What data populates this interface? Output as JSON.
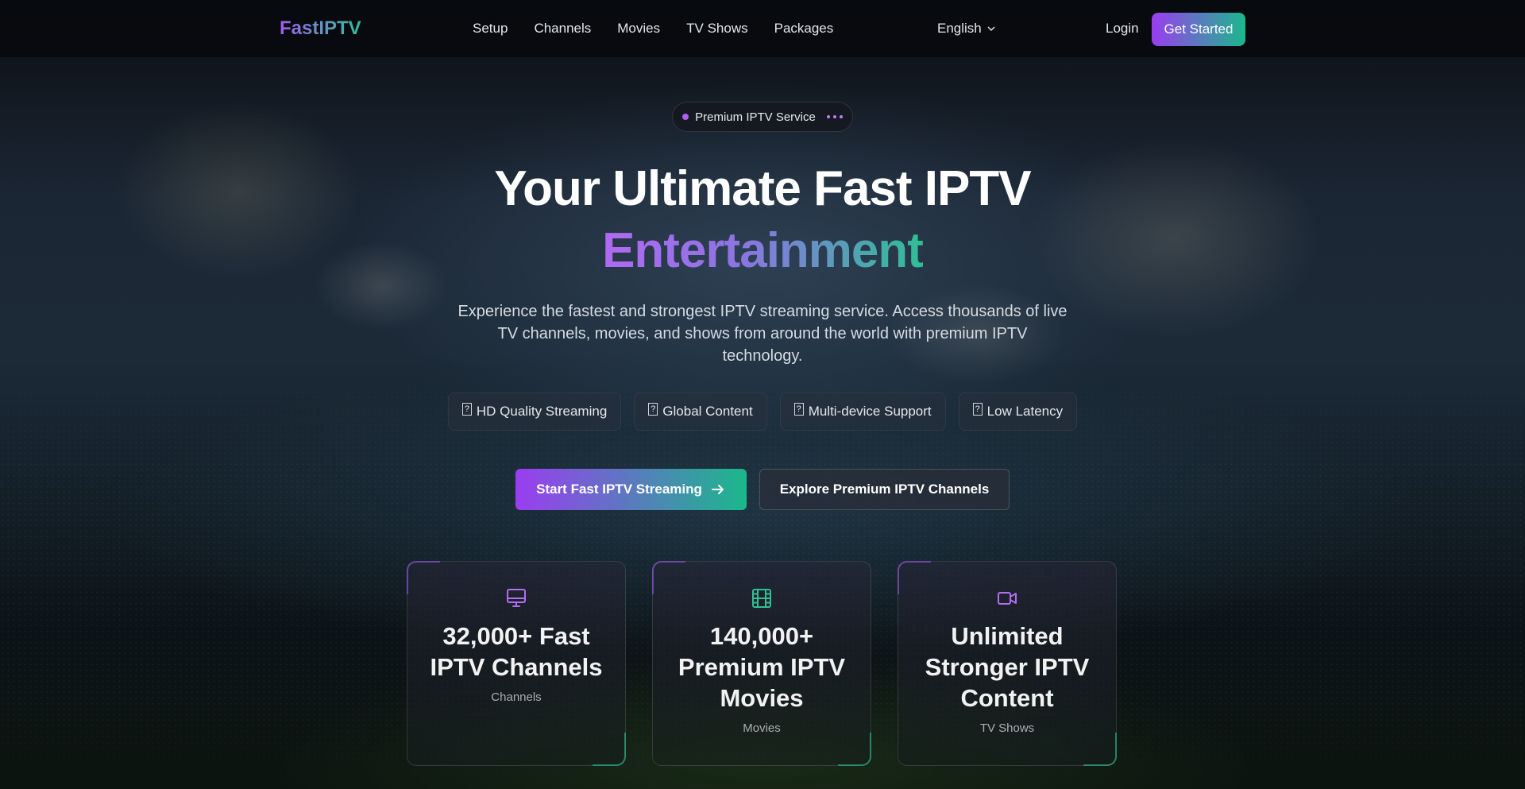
{
  "brand": {
    "logo": "FastIPTV",
    "accent_purple": "#9a3df0",
    "accent_green": "#1bb88c"
  },
  "nav": {
    "links": [
      "Setup",
      "Channels",
      "Movies",
      "TV Shows",
      "Packages"
    ],
    "language": "English",
    "login": "Login",
    "get_started": "Get Started"
  },
  "hero": {
    "badge": "Premium IPTV Service",
    "title_line1": "Your Ultimate Fast IPTV",
    "title_line2": "Entertainment",
    "subtitle": "Experience the fastest and strongest IPTV streaming service. Access thousands of live TV channels, movies, and shows from around the world with premium IPTV technology.",
    "features": [
      {
        "icon": "unknown-glyph-icon",
        "label": "HD Quality Streaming"
      },
      {
        "icon": "unknown-glyph-icon",
        "label": "Global Content"
      },
      {
        "icon": "unknown-glyph-icon",
        "label": "Multi-device Support"
      },
      {
        "icon": "unknown-glyph-icon",
        "label": "Low Latency"
      }
    ],
    "primary_cta": "Start Fast IPTV Streaming",
    "secondary_cta": "Explore Premium IPTV Channels"
  },
  "stats": [
    {
      "icon": "monitor-icon",
      "title": "32,000+ Fast IPTV Channels",
      "label": "Channels"
    },
    {
      "icon": "film-icon",
      "title": "140,000+ Premium IPTV Movies",
      "label": "Movies"
    },
    {
      "icon": "video-camera-icon",
      "title": "Unlimited Stronger IPTV Content",
      "label": "TV Shows"
    }
  ]
}
